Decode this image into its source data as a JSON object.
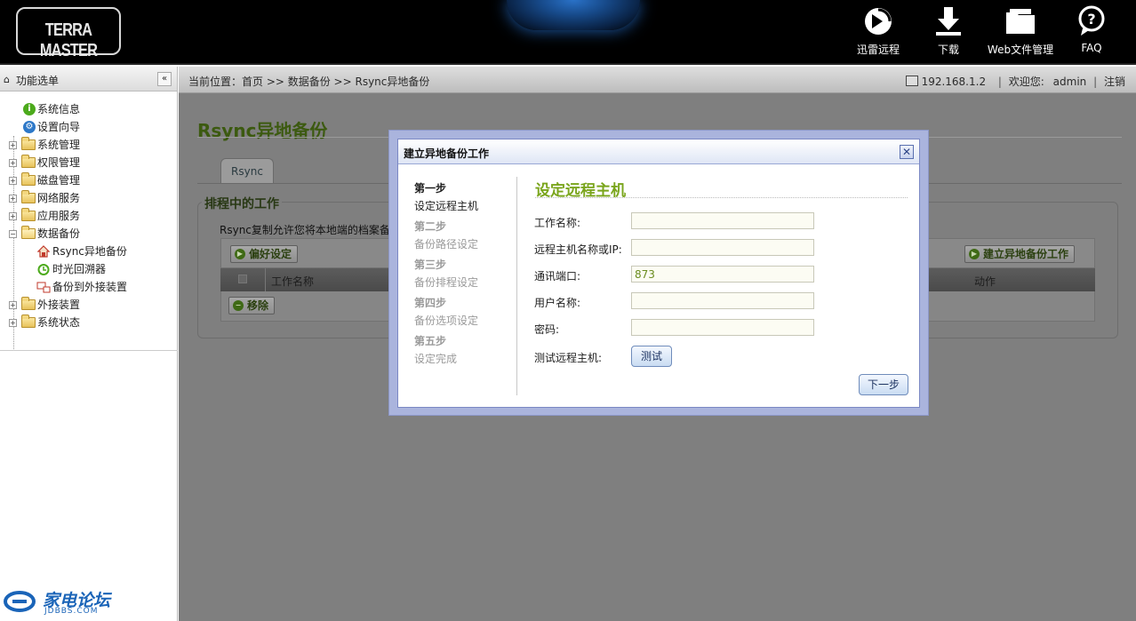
{
  "header": {
    "logo": "TERRA MASTER",
    "buttons": [
      {
        "label": "迅雷远程",
        "icon": "thunder-remote-icon"
      },
      {
        "label": "下载",
        "icon": "download-icon"
      },
      {
        "label": "Web文件管理",
        "icon": "folder-icon"
      },
      {
        "label": "FAQ",
        "icon": "help-icon"
      }
    ]
  },
  "sidebar": {
    "title": "功能选单",
    "collapse": "«",
    "items": [
      {
        "label": "系统信息",
        "icon": "info-icon"
      },
      {
        "label": "设置向导",
        "icon": "wizard-gear-icon"
      },
      {
        "label": "系统管理",
        "icon": "folder-icon"
      },
      {
        "label": "权限管理",
        "icon": "folder-icon"
      },
      {
        "label": "磁盘管理",
        "icon": "folder-icon"
      },
      {
        "label": "网络服务",
        "icon": "folder-icon"
      },
      {
        "label": "应用服务",
        "icon": "folder-icon"
      },
      {
        "label": "数据备份",
        "icon": "folder-open-icon"
      },
      {
        "label": "Rsync异地备份",
        "icon": "rsync-icon"
      },
      {
        "label": "时光回溯器",
        "icon": "time-machine-icon"
      },
      {
        "label": "备份到外接装置",
        "icon": "external-backup-icon"
      },
      {
        "label": "外接装置",
        "icon": "folder-icon"
      },
      {
        "label": "系统状态",
        "icon": "folder-icon"
      }
    ],
    "footer_logo": "家电论坛",
    "footer_sub": "JDBBS.COM"
  },
  "breadcrumb": "当前位置：首页 >> 数据备份 >> Rsync异地备份",
  "userbar": {
    "ip": "192.168.1.2",
    "welcome": "欢迎您:",
    "user": "admin",
    "logout": "注销"
  },
  "page": {
    "title": "Rsync异地备份",
    "tab": "Rsync",
    "section": "排程中的工作",
    "description": "Rsync复制允许您将本地端的档案备份",
    "buttons": {
      "preferences": "偏好设定",
      "create_job": "建立异地备份工作",
      "remove": "移除"
    },
    "table": {
      "columns": [
        "工作名称",
        "动作"
      ]
    }
  },
  "dialog": {
    "title": "建立异地备份工作",
    "close": "✕",
    "steps": [
      {
        "title": "第一步",
        "sub": "设定远程主机",
        "active": true
      },
      {
        "title": "第二步",
        "sub": "备份路径设定",
        "active": false
      },
      {
        "title": "第三步",
        "sub": "备份排程设定",
        "active": false
      },
      {
        "title": "第四步",
        "sub": "备份选项设定",
        "active": false
      },
      {
        "title": "第五步",
        "sub": "设定完成",
        "active": false
      }
    ],
    "form_title": "设定远程主机",
    "fields": {
      "job_name_label": "工作名称:",
      "job_name_value": "",
      "host_label": "远程主机名称或IP:",
      "host_value": "",
      "port_label": "通讯端口:",
      "port_value": "873",
      "username_label": "用户名称:",
      "username_value": "",
      "password_label": "密码:",
      "password_value": "",
      "test_label": "测试远程主机:"
    },
    "test_button": "测试",
    "next_button": "下一步"
  },
  "colors": {
    "accent_green": "#7aa51c",
    "title_green": "#3c5a10",
    "overlay": "#808080",
    "dialog_border": "#aab4dd"
  }
}
